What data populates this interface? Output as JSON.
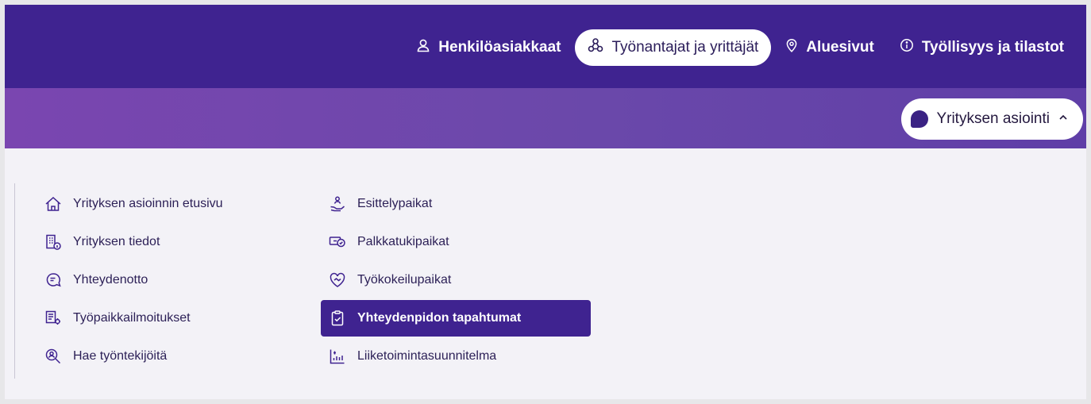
{
  "topnav": {
    "items": [
      {
        "label": "Henkilöasiakkaat",
        "icon": "person-icon",
        "active": false
      },
      {
        "label": "Työnantajat ja yrittäjät",
        "icon": "network-icon",
        "active": true
      },
      {
        "label": "Aluesivut",
        "icon": "location-pin-icon",
        "active": false
      },
      {
        "label": "Työllisyys ja tilastot",
        "icon": "info-icon",
        "active": false
      }
    ]
  },
  "subbar": {
    "business_button_label": "Yrityksen asiointi",
    "business_button_icon": "chevron-up-icon"
  },
  "menu": {
    "column1": [
      {
        "label": "Yrityksen asioinnin etusivu",
        "icon": "home-icon"
      },
      {
        "label": "Yrityksen tiedot",
        "icon": "building-info-icon"
      },
      {
        "label": "Yhteydenotto",
        "icon": "chat-bubble-icon"
      },
      {
        "label": "Työpaikkailmoitukset",
        "icon": "job-posting-icon"
      },
      {
        "label": "Hae työntekijöitä",
        "icon": "search-people-icon"
      }
    ],
    "column2": [
      {
        "label": "Esittelypaikat",
        "icon": "hand-people-icon"
      },
      {
        "label": "Palkkatukipaikat",
        "icon": "salary-support-icon"
      },
      {
        "label": "Työkokeilupaikat",
        "icon": "heart-handshake-icon"
      },
      {
        "label": "Yhteydenpidon tapahtumat",
        "icon": "clipboard-check-icon",
        "active": true
      },
      {
        "label": "Liiketoimintasuunnitelma",
        "icon": "business-chart-icon"
      }
    ]
  },
  "colors": {
    "topbar": "#3f2390",
    "accent": "#3f2390",
    "subbar_gradient_start": "#7a46b0",
    "subbar_gradient_end": "#5f3ea7",
    "menu_text": "#2b1f56",
    "background": "#f3f2f7"
  }
}
